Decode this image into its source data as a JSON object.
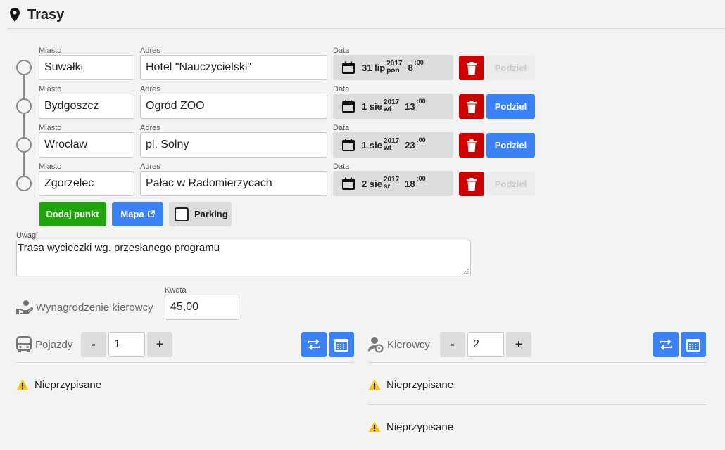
{
  "header": {
    "title": "Trasy",
    "icon": "map-pin-icon"
  },
  "labels": {
    "city": "Miasto",
    "address": "Adres",
    "date": "Data"
  },
  "stops": [
    {
      "city": "Suwałki",
      "address": "Hotel \"Nauczycielski\"",
      "day_month": "31 lip",
      "year": "2017",
      "weekday": "pon",
      "hour": "8",
      "minute": ":00",
      "split": "Podziel",
      "split_enabled": false
    },
    {
      "city": "Bydgoszcz",
      "address": "Ogród ZOO",
      "day_month": "1 sie",
      "year": "2017",
      "weekday": "wt",
      "hour": "13",
      "minute": ":00",
      "split": "Podziel",
      "split_enabled": true
    },
    {
      "city": "Wrocław",
      "address": "pl. Solny",
      "day_month": "1 sie",
      "year": "2017",
      "weekday": "wt",
      "hour": "23",
      "minute": ":00",
      "split": "Podziel",
      "split_enabled": true
    },
    {
      "city": "Zgorzelec",
      "address": "Pałac w Radomierzycach",
      "day_month": "2 sie",
      "year": "2017",
      "weekday": "śr",
      "hour": "18",
      "minute": ":00",
      "split": "Podziel",
      "split_enabled": false
    }
  ],
  "actions": {
    "add_point": "Dodaj punkt",
    "map": "Mapa",
    "parking": "Parking"
  },
  "notes": {
    "label": "Uwagi",
    "value": "Trasa wycieczki wg. przesłanego programu"
  },
  "pay": {
    "label": "Wynagrodzenie kierowcy",
    "amount_label": "Kwota",
    "amount": "45,00"
  },
  "vehicles": {
    "label": "Pojazdy",
    "minus": "-",
    "plus": "+",
    "count": "1",
    "unassigned": [
      "Nieprzypisane"
    ]
  },
  "drivers": {
    "label": "Kierowcy",
    "minus": "-",
    "plus": "+",
    "count": "2",
    "unassigned": [
      "Nieprzypisane",
      "Nieprzypisane"
    ]
  },
  "colors": {
    "primary": "#3b82f6",
    "danger": "#cc0000",
    "success": "#1ea50c",
    "warning": "#f5c400",
    "background": "#f3f3f3"
  }
}
